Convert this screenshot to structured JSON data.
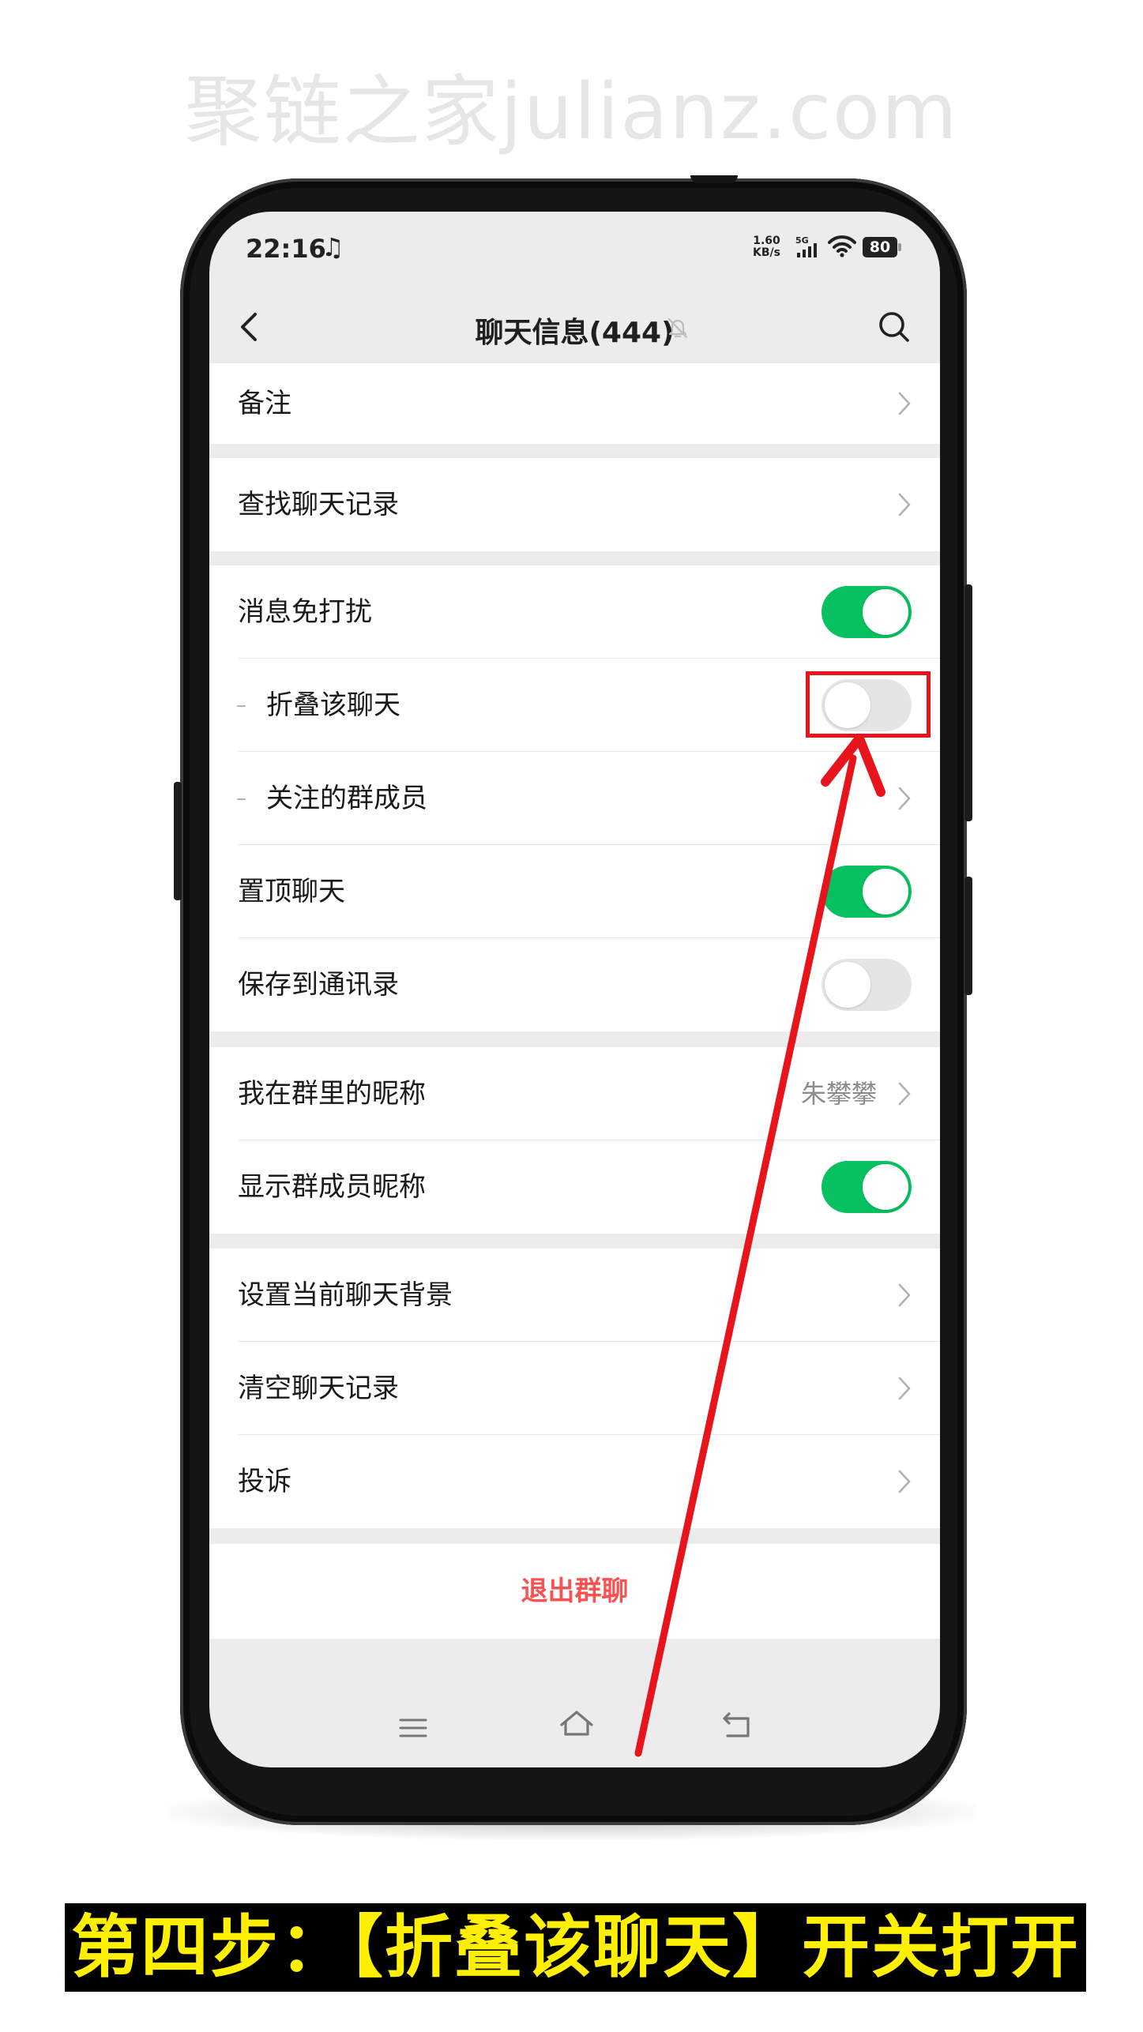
{
  "watermark": "聚链之家julianz.com",
  "status_bar": {
    "time": "22:16",
    "speed_value": "1.60",
    "speed_unit": "KB/s",
    "network": "5G",
    "battery": "80"
  },
  "nav": {
    "title": "聊天信息(444)"
  },
  "groups": [
    {
      "rows": [
        {
          "label": "备注",
          "type": "chevron"
        }
      ]
    },
    {
      "rows": [
        {
          "label": "查找聊天记录",
          "type": "chevron"
        }
      ]
    },
    {
      "rows": [
        {
          "label": "消息免打扰",
          "type": "toggle",
          "on": true
        },
        {
          "label": "折叠该聊天",
          "type": "toggle",
          "on": false,
          "sub": true
        },
        {
          "label": "关注的群成员",
          "type": "chevron",
          "sub": true
        },
        {
          "label": "置顶聊天",
          "type": "toggle",
          "on": true
        },
        {
          "label": "保存到通讯录",
          "type": "toggle",
          "on": false
        }
      ]
    },
    {
      "rows": [
        {
          "label": "我在群里的昵称",
          "type": "chevron",
          "value": "朱攀攀"
        },
        {
          "label": "显示群成员昵称",
          "type": "toggle",
          "on": true
        }
      ]
    },
    {
      "rows": [
        {
          "label": "设置当前聊天背景",
          "type": "chevron"
        },
        {
          "label": "清空聊天记录",
          "type": "chevron"
        },
        {
          "label": "投诉",
          "type": "chevron"
        }
      ]
    }
  ],
  "exit_label": "退出群聊",
  "caption": "第四步：【折叠该聊天】开关打开",
  "colors": {
    "toggle_on": "#07c160",
    "toggle_off": "#e5e5e5",
    "exit_text": "#fa5151",
    "annotation": "#e8141c",
    "caption_text": "#ffef00",
    "caption_bg": "#000000"
  }
}
